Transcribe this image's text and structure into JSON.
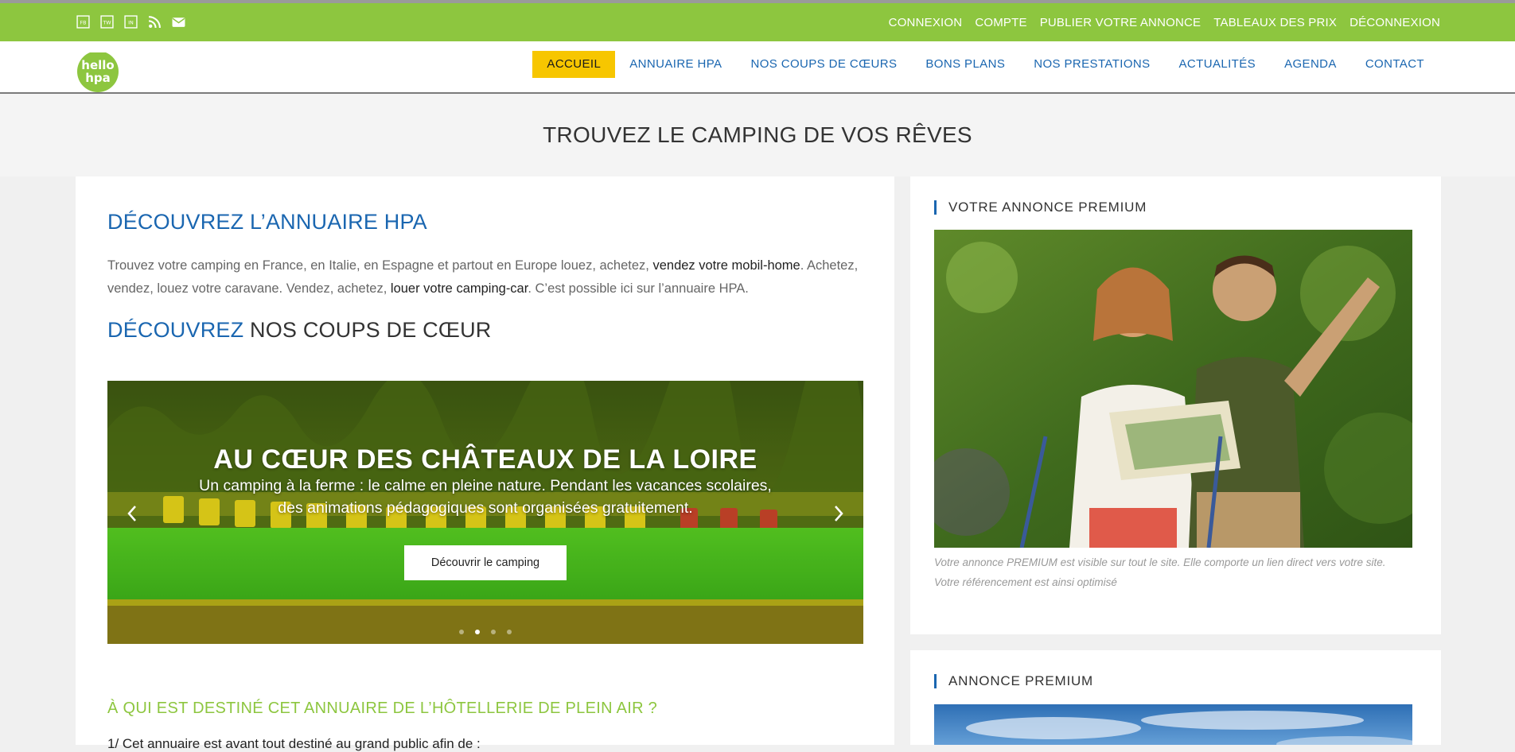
{
  "topbar": {
    "social_icons": [
      "facebook-icon",
      "twitter-icon",
      "linkedin-icon",
      "rss-icon",
      "mail-icon"
    ],
    "links": [
      "CONNEXION",
      "COMPTE",
      "PUBLIER VOTRE ANNONCE",
      "TABLEAUX DES PRIX",
      "DÉCONNEXION"
    ]
  },
  "header": {
    "logo_text_top": "hello",
    "logo_text_bottom": "hpa",
    "nav": [
      "ACCUEIL",
      "ANNUAIRE HPA",
      "NOS COUPS DE CŒURS",
      "BONS PLANS",
      "NOS PRESTATIONS",
      "ACTUALITÉS",
      "AGENDA",
      "CONTACT"
    ],
    "active_nav": "ACCUEIL"
  },
  "band": {
    "title": "TROUVEZ LE CAMPING DE VOS RÊVES"
  },
  "main": {
    "heading1": "DÉCOUVREZ L’ANNUAIRE HPA",
    "intro": {
      "part1": "Trouvez votre camping en France, en Italie, en Espagne et partout en Europe louez, achetez, ",
      "link1": "vendez votre mobil-home",
      "part2": ". Achetez, vendez, louez votre caravane. Vendez, achetez, ",
      "link2": "louer votre camping-car",
      "part3": ". C’est possible ici sur l’annuaire HPA."
    },
    "heading2_blue": "DÉCOUVREZ",
    "heading2_dark": " NOS COUPS DE CŒUR",
    "slider": {
      "title": "AU CŒUR DES CHÂTEAUX DE LA LOIRE",
      "description": "Un camping à la ferme : le calme en pleine nature. Pendant les vacances scolaires, des animations pédagogiques sont organisées gratuitement.",
      "button": "Découvrir le camping",
      "dots": 4,
      "active_dot": 2
    },
    "heading3": "À QUI EST DESTINÉ CET ANNUAIRE DE L’HÔTELLERIE DE PLEIN AIR ?",
    "cut_text": "1/ Cet annuaire est avant tout destiné au grand public afin de :"
  },
  "sidebar": {
    "widget1_title": "VOTRE ANNONCE PREMIUM",
    "widget1_caption": "Votre annonce PREMIUM est visible sur tout le site. Elle comporte un lien direct vers votre site. Votre référencement est ainsi optimisé",
    "widget2_title": "ANNONCE PREMIUM"
  },
  "colors": {
    "green": "#8dc63f",
    "blue": "#1a66b0",
    "yellow": "#f7c600"
  }
}
